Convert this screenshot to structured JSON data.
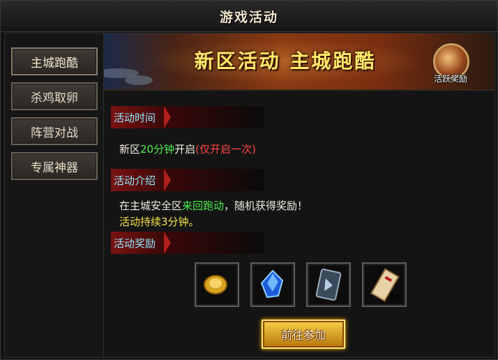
{
  "window": {
    "title": "游戏活动"
  },
  "sidebar": {
    "items": [
      {
        "label": "主城跑酷",
        "active": true
      },
      {
        "label": "杀鸡取卵",
        "active": false
      },
      {
        "label": "阵营对战",
        "active": false
      },
      {
        "label": "专属神器",
        "active": false
      }
    ]
  },
  "banner": {
    "title": "新区活动  主城跑酷",
    "badge_label": "活跃奖励",
    "badge_icon": "medal-icon"
  },
  "sections": {
    "time": {
      "header": "活动时间",
      "text_1": "新区",
      "text_2": "20分钟",
      "text_3": "开启",
      "text_4": "(仅开启一次)"
    },
    "intro": {
      "header": "活动介绍",
      "text_1": "在主城安全区",
      "text_2": "来回跑动",
      "text_3": "，随机获得奖励！",
      "line2": "活动持续3分钟。"
    },
    "rewards": {
      "header": "活动奖励",
      "items": [
        {
          "icon": "gold-coin-icon"
        },
        {
          "icon": "blue-crystal-icon"
        },
        {
          "icon": "skill-card-icon"
        },
        {
          "icon": "scroll-ticket-icon",
          "count": "10"
        }
      ]
    }
  },
  "action": {
    "join_label": "前往参加"
  },
  "colors": {
    "accent_gold": "#ffe76a",
    "header_cyan": "#8ee8ff",
    "green": "#4cf04c",
    "red": "#ff4848",
    "yellow": "#f3e24a"
  }
}
